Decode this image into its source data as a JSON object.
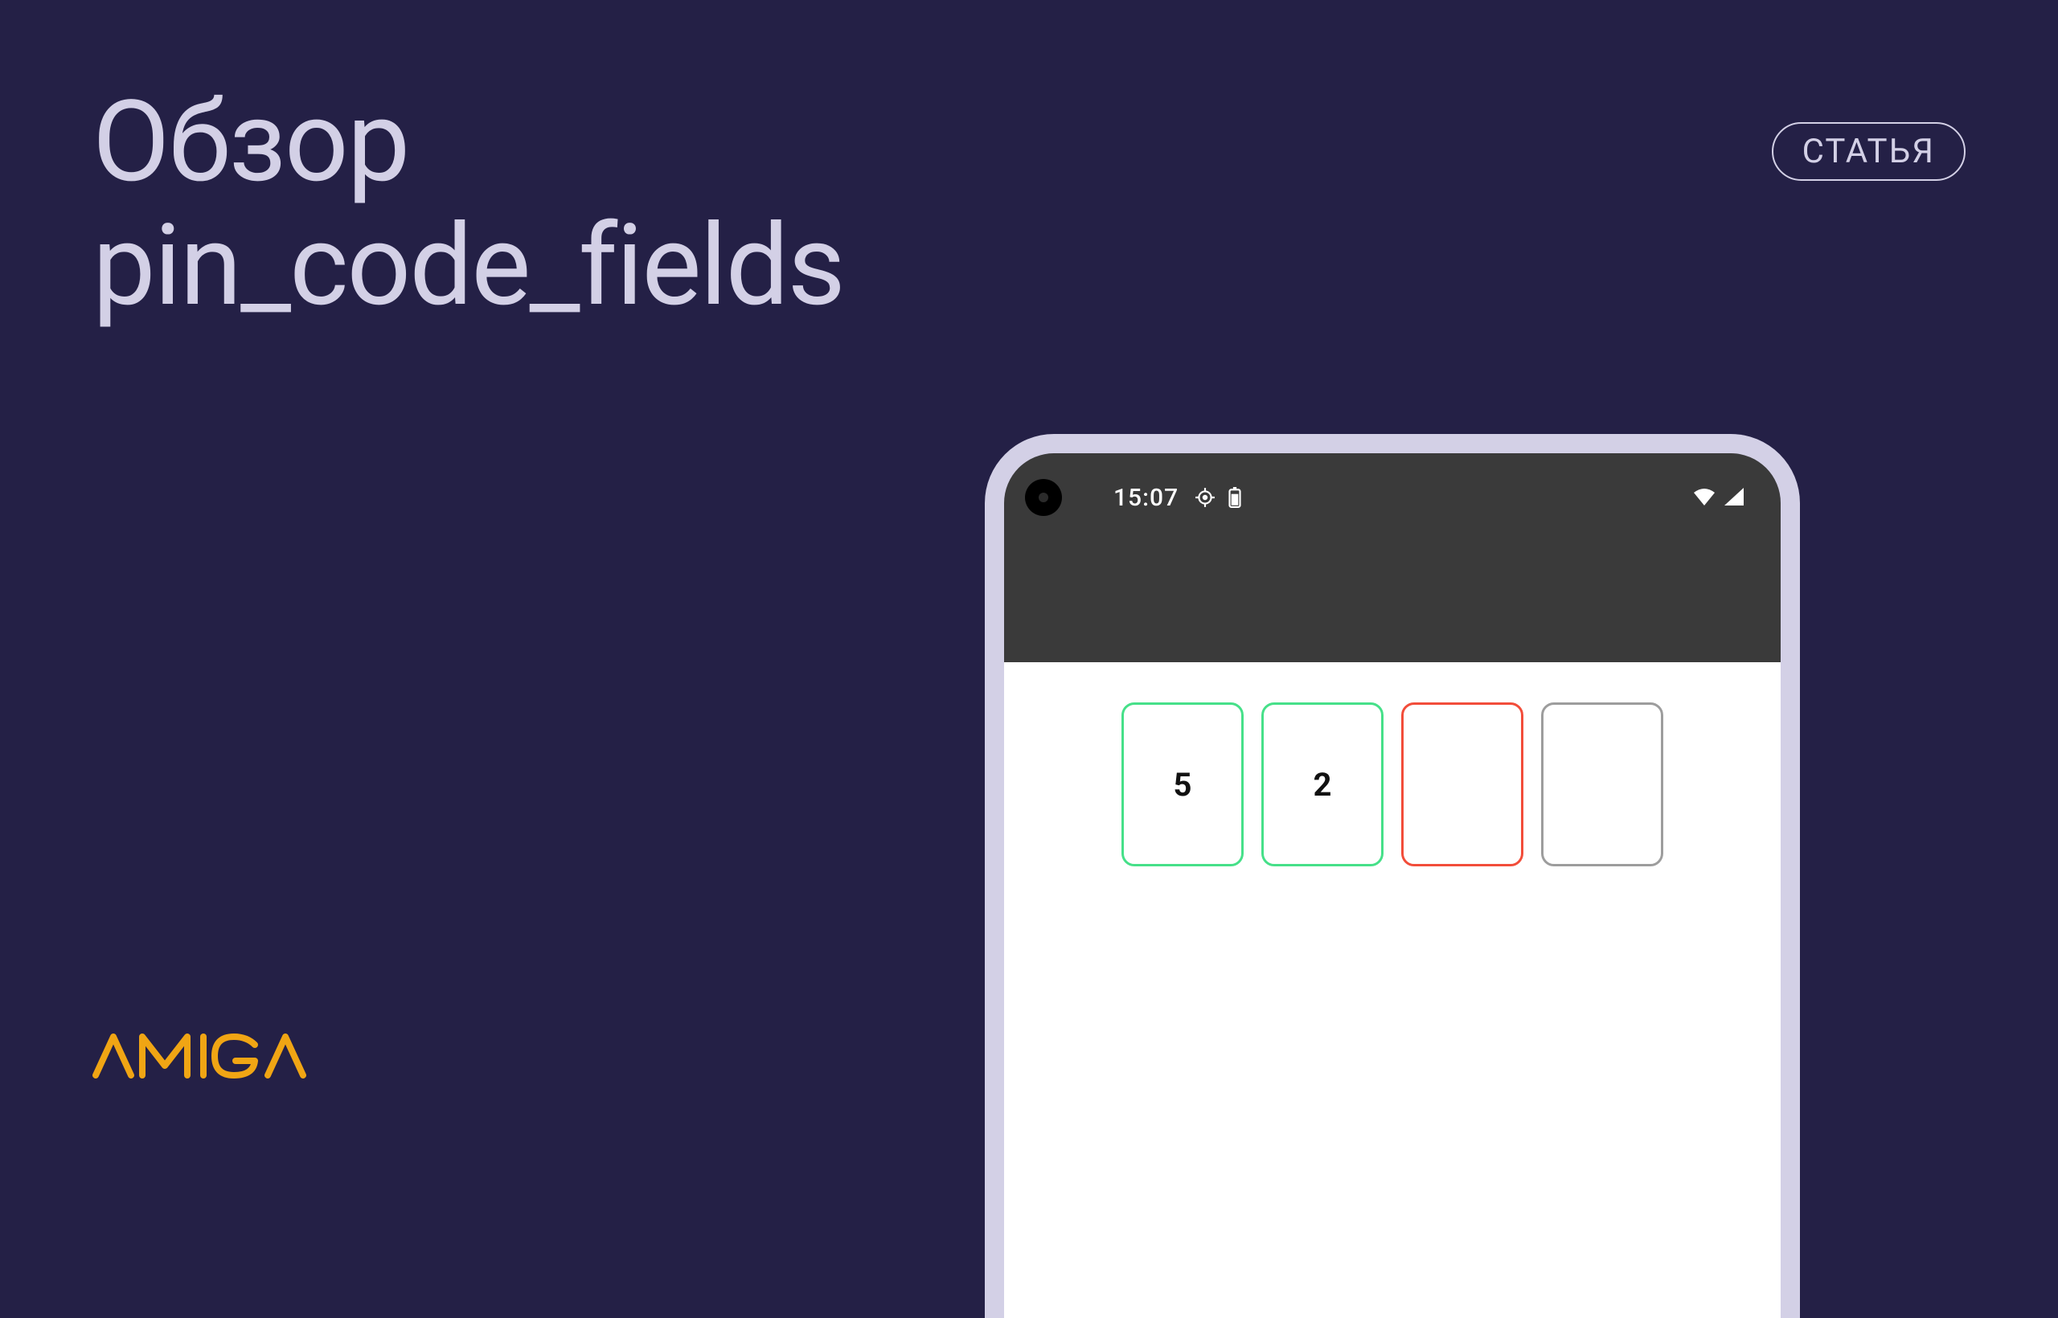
{
  "title_line1": "Обзор",
  "title_line2": "pin_code_fields",
  "badge_label": "СТАТЬЯ",
  "logo_text": "AMIGA",
  "phone": {
    "status_time": "15:07",
    "pin_fields": [
      {
        "value": "5",
        "state": "filled"
      },
      {
        "value": "2",
        "state": "filled"
      },
      {
        "value": "",
        "state": "active"
      },
      {
        "value": "",
        "state": "inactive"
      }
    ]
  },
  "colors": {
    "background": "#242046",
    "text_light": "#d3d0e6",
    "logo": "#f0a514",
    "pin_filled": "#46e089",
    "pin_active": "#f24d3a",
    "pin_inactive": "#9d9d9d"
  }
}
